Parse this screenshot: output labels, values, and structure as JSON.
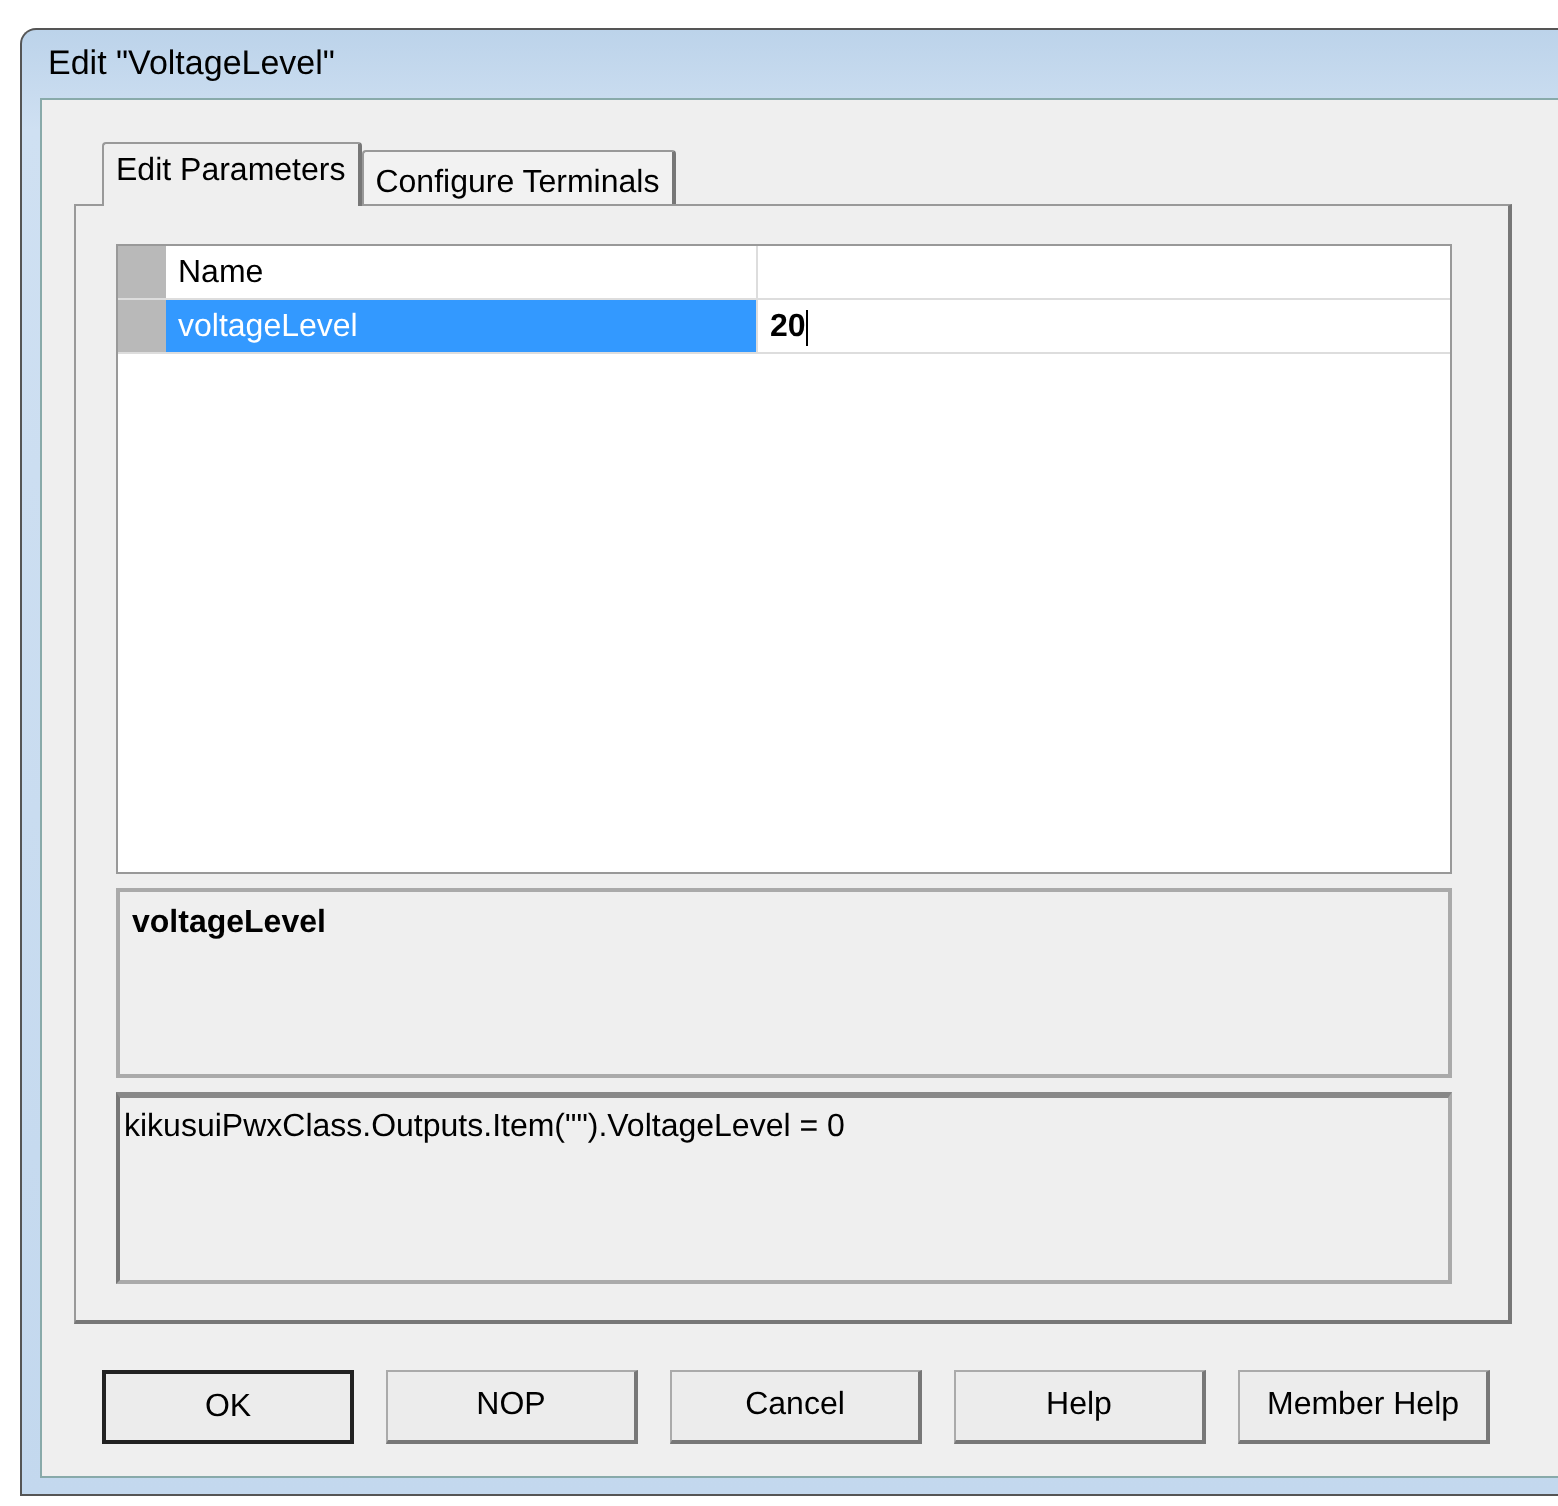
{
  "window": {
    "title": "Edit \"VoltageLevel\""
  },
  "tabs": [
    {
      "label": "Edit Parameters",
      "selected": true
    },
    {
      "label": "Configure Terminals",
      "selected": false
    }
  ],
  "grid": {
    "rows": [
      {
        "name": "Name",
        "selected": false
      },
      {
        "name": "voltageLevel",
        "value": "20",
        "selected": true,
        "editing": true
      }
    ]
  },
  "description": {
    "title": "voltageLevel"
  },
  "code_preview": {
    "text": "kikusuiPwxClass.Outputs.Item(\"\").VoltageLevel = 0"
  },
  "buttons": [
    {
      "label": "OK",
      "default": true
    },
    {
      "label": "NOP",
      "default": false
    },
    {
      "label": "Cancel",
      "default": false
    },
    {
      "label": "Help",
      "default": false
    },
    {
      "label": "Member Help",
      "default": false
    }
  ]
}
